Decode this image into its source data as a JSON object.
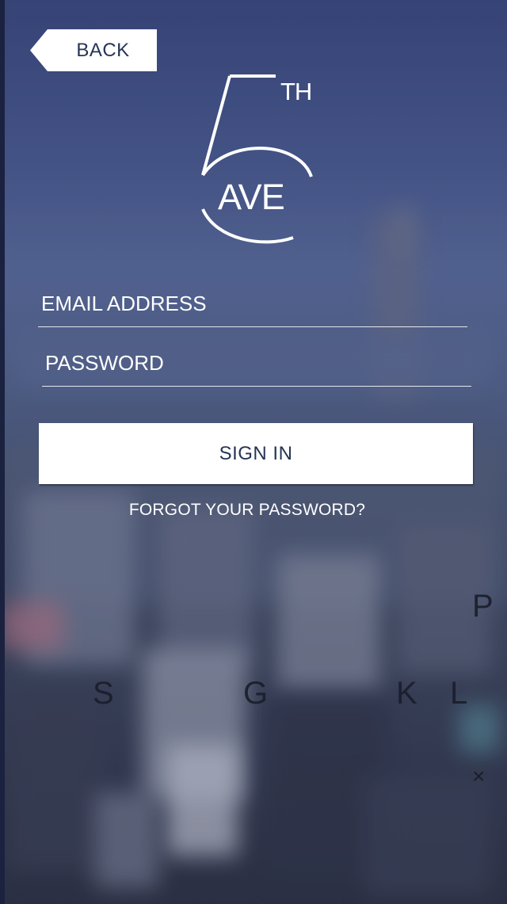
{
  "back_button": {
    "label": "BACK"
  },
  "logo": {
    "numeral": "5",
    "superscript": "TH",
    "word": "AVE"
  },
  "form": {
    "email": {
      "placeholder": "EMAIL ADDRESS",
      "value": ""
    },
    "password": {
      "placeholder": "PASSWORD",
      "value": ""
    },
    "sign_in_label": "SIGN IN",
    "forgot_password_label": "FORGOT YOUR PASSWORD?"
  },
  "keyboard": {
    "visible_keys": [
      "P",
      "S",
      "G",
      "K",
      "L"
    ],
    "delete_key": "×"
  },
  "colors": {
    "accent_navy": "#263556",
    "background_blue": "#3d4a72",
    "text_white": "#ffffff"
  },
  "background": {
    "description_icon": "city-skyline-background"
  }
}
